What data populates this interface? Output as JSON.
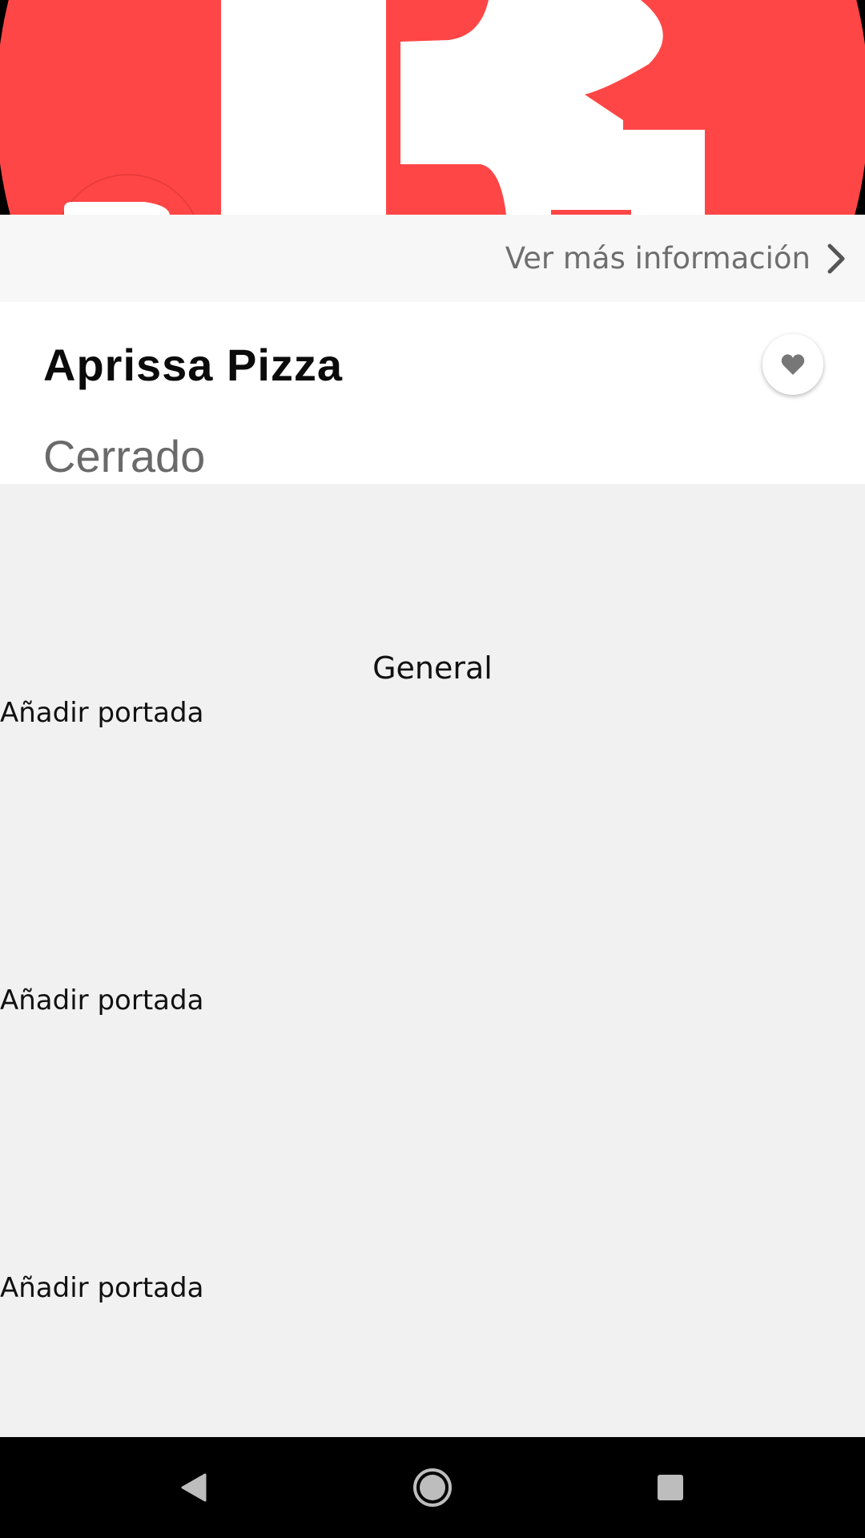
{
  "restaurant": {
    "name": "Aprissa Pizza",
    "status": "Cerrado"
  },
  "info_link": {
    "label": "Ver más información",
    "icon": "chevron-right-icon"
  },
  "favorite": {
    "icon": "heart-icon"
  },
  "section": {
    "title": "General"
  },
  "add_cover_items": [
    {
      "label": "Añadir portada"
    },
    {
      "label": "Añadir portada"
    },
    {
      "label": "Añadir portada"
    }
  ],
  "navbar": {
    "back_icon": "back-triangle-icon",
    "home_icon": "home-circle-icon",
    "recents_icon": "recents-square-icon"
  },
  "colors": {
    "brand_red": "#ff4646",
    "background": "#f1f1f1",
    "status_gray": "#6a6a6a"
  }
}
